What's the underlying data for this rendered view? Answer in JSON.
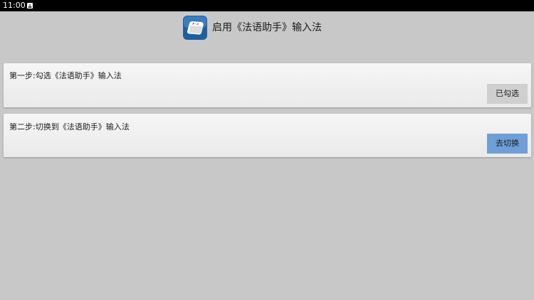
{
  "status_bar": {
    "time": "11:00",
    "notification_icon": "android-notification-icon"
  },
  "header": {
    "app_icon": "keyboard-key-icon",
    "title": "启用《法语助手》输入法"
  },
  "steps": [
    {
      "text": "第一步:勾选《法语助手》输入法",
      "button_label": "已勾选",
      "button_color": "#cfcfcf"
    },
    {
      "text": "第二步:切换到《法语助手》输入法",
      "button_label": "去切换",
      "button_color": "#6f9fd8"
    }
  ],
  "colors": {
    "background": "#c8c8c8",
    "status_bar": "#000000",
    "card": "#efefef"
  }
}
